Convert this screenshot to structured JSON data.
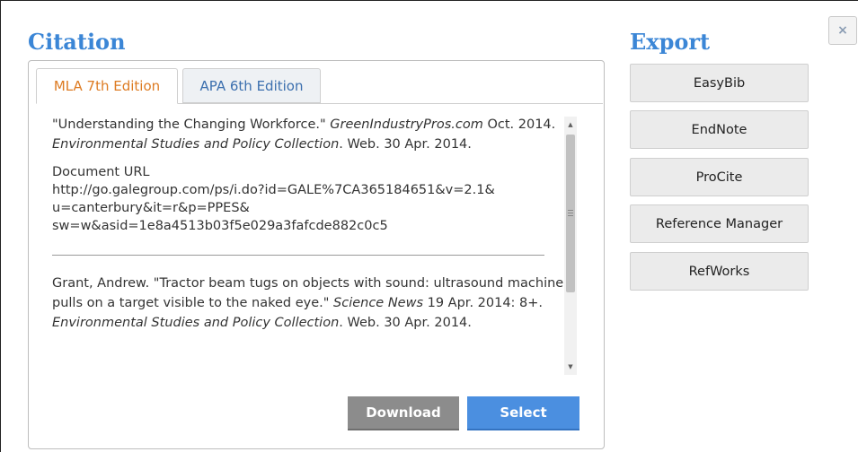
{
  "citation": {
    "heading": "Citation",
    "tabs": [
      {
        "label": "MLA 7th Edition",
        "active": true
      },
      {
        "label": "APA 6th Edition",
        "active": false
      }
    ],
    "entries": [
      {
        "part1": "\"Understanding the Changing Workforce.\" ",
        "italic1": "GreenIndustryPros.com",
        "part2": " Oct. 2014. ",
        "italic2": "Environmental Studies and Policy Collection",
        "part3": ". Web. 30 Apr. 2014.",
        "url_label": "Document URL",
        "url_lines": [
          "http://go.galegroup.com/ps/i.do?id=GALE%7CA365184651&v=2.1&",
          "u=canterbury&it=r&p=PPES&",
          "sw=w&asid=1e8a4513b03f5e029a3fafcde882c0c5"
        ]
      },
      {
        "part1": "Grant, Andrew. \"Tractor beam tugs on objects with sound: ultrasound machine pulls on a target visible to the naked eye.\" ",
        "italic1": "Science News",
        "part2": " 19 Apr. 2014: 8+. ",
        "italic2": "Environmental Studies and Policy Collection",
        "part3": ". Web. 30 Apr. 2014."
      }
    ],
    "download_label": "Download",
    "select_label": "Select"
  },
  "export": {
    "heading": "Export",
    "buttons": [
      "EasyBib",
      "EndNote",
      "ProCite",
      "Reference Manager",
      "RefWorks"
    ]
  },
  "close_label": "×",
  "colors": {
    "heading": "#3b86d6",
    "active_tab": "#dd7b22",
    "inactive_tab": "#3b6fae",
    "select_button": "#4b8fe0",
    "download_button": "#8c8c8c"
  }
}
